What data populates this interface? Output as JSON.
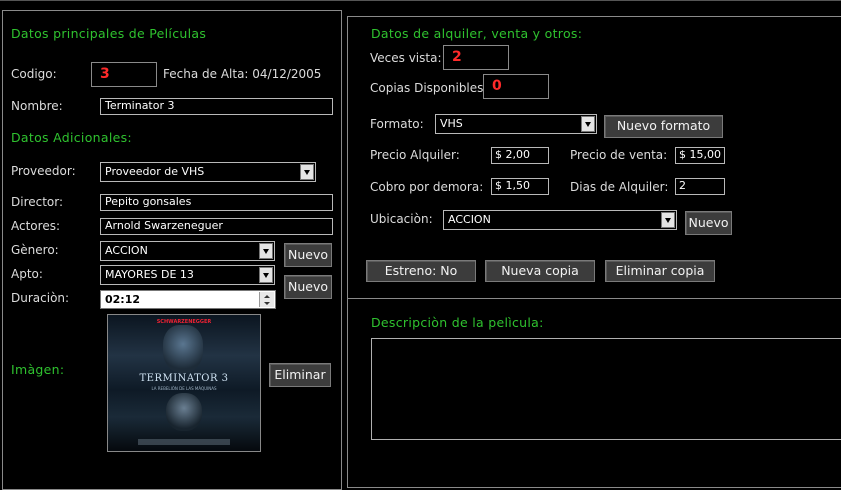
{
  "colors": {
    "accent_green": "#2fc22f",
    "value_red": "#ff2a2a",
    "background": "#000000"
  },
  "left": {
    "section_title": "Datos principales de Películas",
    "codigo_label": "Codigo:",
    "codigo_value": "3",
    "fecha_alta": "Fecha de Alta: 04/12/2005",
    "nombre_label": "Nombre:",
    "nombre_value": "Terminator 3",
    "adicionales_title": "Datos Adicionales:",
    "proveedor_label": "Proveedor:",
    "proveedor_value": "Proveedor de VHS",
    "director_label": "Director:",
    "director_value": "Pepito gonsales",
    "actores_label": "Actores:",
    "actores_value": "Arnold Swarzeneguer",
    "genero_label": "Gènero:",
    "genero_value": "ACCION",
    "apto_label": "Apto:",
    "apto_value": "MAYORES DE 13",
    "duracion_label": "Duraciòn:",
    "duracion_value": "02:12",
    "nuevo_label": "Nuevo",
    "imagen_label": "Imàgen:",
    "eliminar_label": "Eliminar",
    "poster": {
      "top_text": "SCHWARZENEGGER",
      "title": "TERMINATOR 3",
      "subtitle": "LA REBELIÓN DE LAS MÁQUINAS"
    }
  },
  "right": {
    "section_title": "Datos de alquiler, venta y otros:",
    "veces_label": "Veces vista:",
    "veces_value": "2",
    "copias_label": "Copias Disponibles:",
    "copias_value": "0",
    "formato_label": "Formato:",
    "formato_value": "VHS",
    "nuevo_formato_label": "Nuevo formato",
    "precio_alquiler_label": "Precio Alquiler:",
    "precio_alquiler_value": "$ 2,00",
    "precio_venta_label": "Precio de venta:",
    "precio_venta_value": "$ 15,00",
    "cobro_label": "Cobro por demora:",
    "cobro_value": "$ 1,50",
    "dias_label": "Dias de Alquiler:",
    "dias_value": "2",
    "ubicacion_label": "Ubicaciòn:",
    "ubicacion_value": "ACCION",
    "nuevo_label": "Nuevo",
    "estreno_label": "Estreno: No",
    "nueva_copia_label": "Nueva copia",
    "eliminar_copia_label": "Eliminar copia",
    "descripcion_title": "Descripciòn de la pelìcula:",
    "descripcion_value": ""
  }
}
